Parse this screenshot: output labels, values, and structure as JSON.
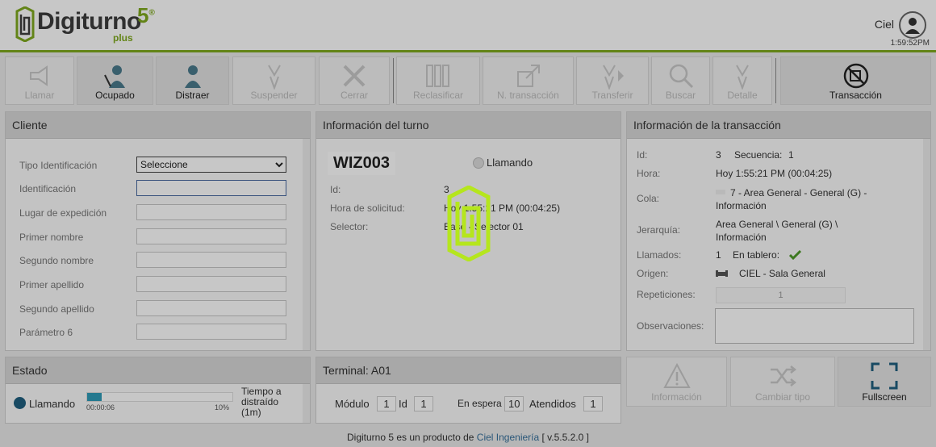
{
  "header": {
    "logo_text": "Digiturno",
    "logo_five": "5",
    "logo_reg": "®",
    "logo_plus": "plus",
    "user_name": "Ciel",
    "clock": "1:59:52PM"
  },
  "toolbar": {
    "llamar": "Llamar",
    "ocupado": "Ocupado",
    "distraer": "Distraer",
    "suspender": "Suspender",
    "cerrar": "Cerrar",
    "reclasificar": "Reclasificar",
    "n_transaccion": "N. transacción",
    "transferir": "Transferir",
    "buscar": "Buscar",
    "detalle": "Detalle",
    "transaccion": "Transacción"
  },
  "cliente": {
    "title": "Cliente",
    "tipo_identificacion": "Tipo Identificación",
    "tipo_identificacion_value": "Seleccione",
    "identificacion": "Identificación",
    "lugar_expedicion": "Lugar de expedición",
    "primer_nombre": "Primer nombre",
    "segundo_nombre": "Segundo nombre",
    "primer_apellido": "Primer apellido",
    "segundo_apellido": "Segundo apellido",
    "parametro6": "Parámetro 6"
  },
  "turno": {
    "title": "Información del turno",
    "code": "WIZ003",
    "status": "Llamando",
    "id_label": "Id:",
    "id_value": "3",
    "hora_label": "Hora de solicitud:",
    "hora_value": "Hoy 1:55:21 PM (00:04:25)",
    "selector_label": "Selector:",
    "selector_value": "Base - Selector 01"
  },
  "transaccion": {
    "title": "Información de la transacción",
    "id_label": "Id:",
    "id_value": "3",
    "secuencia_label": "Secuencia:",
    "secuencia_value": "1",
    "hora_label": "Hora:",
    "hora_value": "Hoy 1:55:21 PM (00:04:25)",
    "cola_label": "Cola:",
    "cola_value": "7 - Area General - General (G) - Información",
    "jerarquia_label": "Jerarquía:",
    "jerarquia_value": "Area General \\ General (G) \\ Información",
    "llamados_label": "Llamados:",
    "llamados_value": "1",
    "tablero_label": "En tablero:",
    "origen_label": "Origen:",
    "origen_value": "CIEL - Sala General",
    "repeticiones_label": "Repeticiones:",
    "repeticiones_value": "1",
    "observaciones_label": "Observaciones:"
  },
  "estado": {
    "title": "Estado",
    "status": "Llamando",
    "timer": "00:00:06",
    "percent_label": "10%",
    "progress": 0.1,
    "tiempo_label": "Tiempo a distraído (1m)"
  },
  "terminal": {
    "title": "Terminal: A01",
    "modulo_label": "Módulo",
    "modulo_value": "1",
    "id_label": "Id",
    "id_value": "1",
    "espera_label": "En espera",
    "espera_value": "10",
    "atendidos_label": "Atendidos",
    "atendidos_value": "1"
  },
  "actions": {
    "informacion": "Información",
    "cambiar_tipo": "Cambiar tipo",
    "fullscreen": "Fullscreen"
  },
  "footer": {
    "prefix": "Digiturno 5 es un producto de ",
    "company": "Ciel Ingeniería",
    "version": " [ v.5.5.2.0 ]"
  },
  "colors": {
    "brand_green": "#7faa1e",
    "spinner_green": "#b5e61d"
  },
  "overlay": {
    "visible": true
  }
}
